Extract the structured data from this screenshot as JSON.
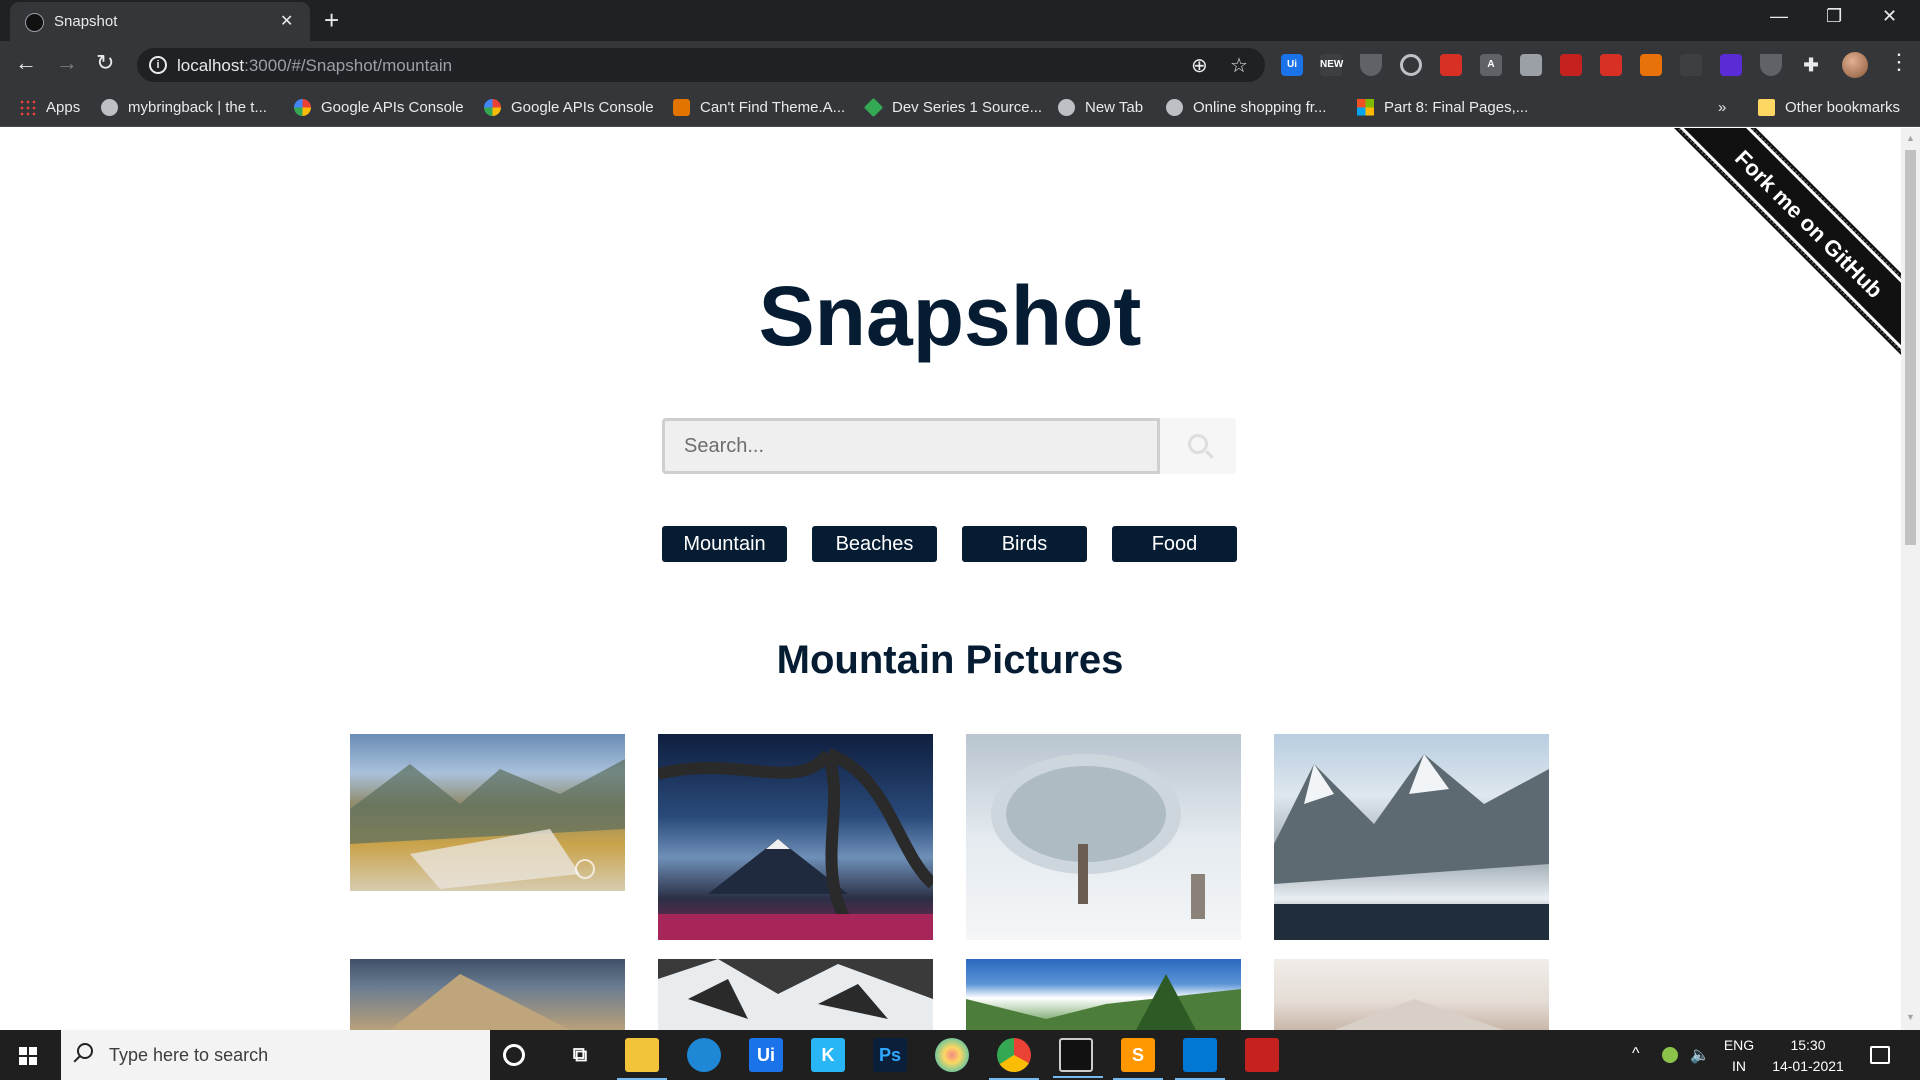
{
  "browser": {
    "tab_title": "Snapshot",
    "url_host": "localhost",
    "url_rest": ":3000/#/Snapshot/mountain",
    "bookmarks": [
      {
        "label": "Apps",
        "icon": "apps-grid-icon"
      },
      {
        "label": "mybringback | the t...",
        "icon": "globe-icon"
      },
      {
        "label": "Google APIs Console",
        "icon": "google-icon"
      },
      {
        "label": "Google APIs Console",
        "icon": "google-icon"
      },
      {
        "label": "Can't Find Theme.A...",
        "icon": "stack-icon"
      },
      {
        "label": "Dev Series 1 Source...",
        "icon": "rocket-icon"
      },
      {
        "label": "New Tab",
        "icon": "globe-icon"
      },
      {
        "label": "Online shopping fr...",
        "icon": "globe-icon"
      },
      {
        "label": "Part 8: Final Pages,...",
        "icon": "microsoft-icon"
      }
    ],
    "more_bookmarks": "»",
    "other_bookmarks": "Other bookmarks",
    "extension_labels": {
      "new_badge": "NEW",
      "a_badge": "A"
    }
  },
  "page": {
    "ribbon": "Fork me on GitHub",
    "title": "Snapshot",
    "search": {
      "placeholder": "Search...",
      "value": ""
    },
    "categories": [
      "Mountain",
      "Beaches",
      "Birds",
      "Food"
    ],
    "section_title": "Mountain Pictures",
    "photos": [
      {
        "alt": "mountain village under snow peaks",
        "colors": [
          "#6a8db6",
          "#c9a34a",
          "#8a8f6a"
        ]
      },
      {
        "alt": "twisted tree framing a volcano",
        "colors": [
          "#1a2f52",
          "#4e6f9c",
          "#a03060"
        ]
      },
      {
        "alt": "snow covered tree",
        "colors": [
          "#e9eef3",
          "#c8d3dc",
          "#8e9ca6"
        ]
      },
      {
        "alt": "snowy valley between mountains",
        "colors": [
          "#9ab7cf",
          "#dfe7ec",
          "#2d3f4f"
        ]
      },
      {
        "alt": "rocky peak",
        "colors": [
          "#4a5a72",
          "#b9a07a",
          "#7a6a52"
        ]
      },
      {
        "alt": "snow patches on rocks",
        "colors": [
          "#2a2a2a",
          "#e8ecef",
          "#6a6a6a"
        ]
      },
      {
        "alt": "green valley under blue sky",
        "colors": [
          "#2f6fc0",
          "#ffffff",
          "#4a8a3a"
        ]
      },
      {
        "alt": "misty mountains",
        "colors": [
          "#ece7e2",
          "#d9d1ca",
          "#b9a79a"
        ]
      }
    ]
  },
  "taskbar": {
    "search_placeholder": "Type here to search",
    "language": "ENG",
    "region": "IN",
    "time": "15:30",
    "date": "14-01-2021",
    "apps": [
      {
        "name": "cortana-icon",
        "label": ""
      },
      {
        "name": "task-view-icon",
        "label": ""
      },
      {
        "name": "file-explorer-icon",
        "label": ""
      },
      {
        "name": "edge-icon",
        "label": ""
      },
      {
        "name": "uipath-icon",
        "label": "Ui"
      },
      {
        "name": "kotlin-icon",
        "label": "K"
      },
      {
        "name": "photoshop-icon",
        "label": "Ps"
      },
      {
        "name": "paint-icon",
        "label": ""
      },
      {
        "name": "chrome-icon",
        "label": ""
      },
      {
        "name": "terminal-icon",
        "label": ""
      },
      {
        "name": "sublime-icon",
        "label": "S"
      },
      {
        "name": "vscode-icon",
        "label": ""
      },
      {
        "name": "mcafee-icon",
        "label": ""
      }
    ]
  }
}
